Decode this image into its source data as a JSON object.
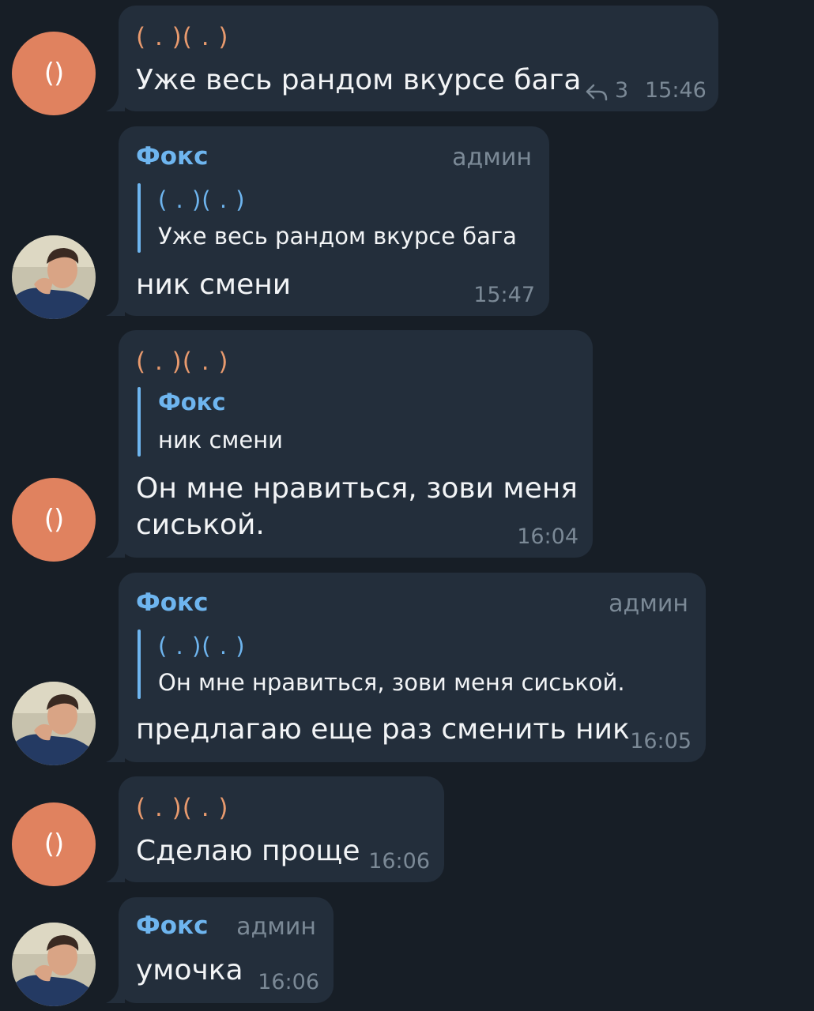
{
  "colors": {
    "background": "#171e26",
    "bubble": "#232e3b",
    "avatar_orange": "#e0825f",
    "name_orange": "#e89a6e",
    "name_blue": "#6eb5ef",
    "muted": "#7b8996"
  },
  "messages": [
    {
      "sender": "( . )( . )",
      "avatar_text": "()",
      "text": "Уже весь рандом вкурсе бага",
      "reply_icon": "reply-arrow-icon",
      "replies": "3",
      "time": "15:46"
    },
    {
      "sender": "Фокс",
      "role": "админ",
      "avatar_icon": "user-photo-icon",
      "quote": {
        "name": "( . )( . )",
        "text": "Уже весь рандом вкурсе бага"
      },
      "text": "ник смени",
      "time": "15:47"
    },
    {
      "sender": "( . )( . )",
      "avatar_text": "()",
      "quote": {
        "name": "Фокс",
        "text": "ник смени"
      },
      "text_line1": "Он мне нравиться, зови меня",
      "text_line2": "сиськой.",
      "time": "16:04"
    },
    {
      "sender": "Фокс",
      "role": "админ",
      "avatar_icon": "user-photo-icon",
      "quote": {
        "name": "( . )( . )",
        "text": "Он мне нравиться, зови меня сиськой."
      },
      "text": "предлагаю еще раз сменить ник",
      "time": "16:05"
    },
    {
      "sender": "( . )( . )",
      "avatar_text": "()",
      "text": "Сделаю проще",
      "time": "16:06"
    },
    {
      "sender": "Фокс",
      "role": "админ",
      "avatar_icon": "user-photo-icon",
      "text": "умочка",
      "time": "16:06"
    }
  ]
}
